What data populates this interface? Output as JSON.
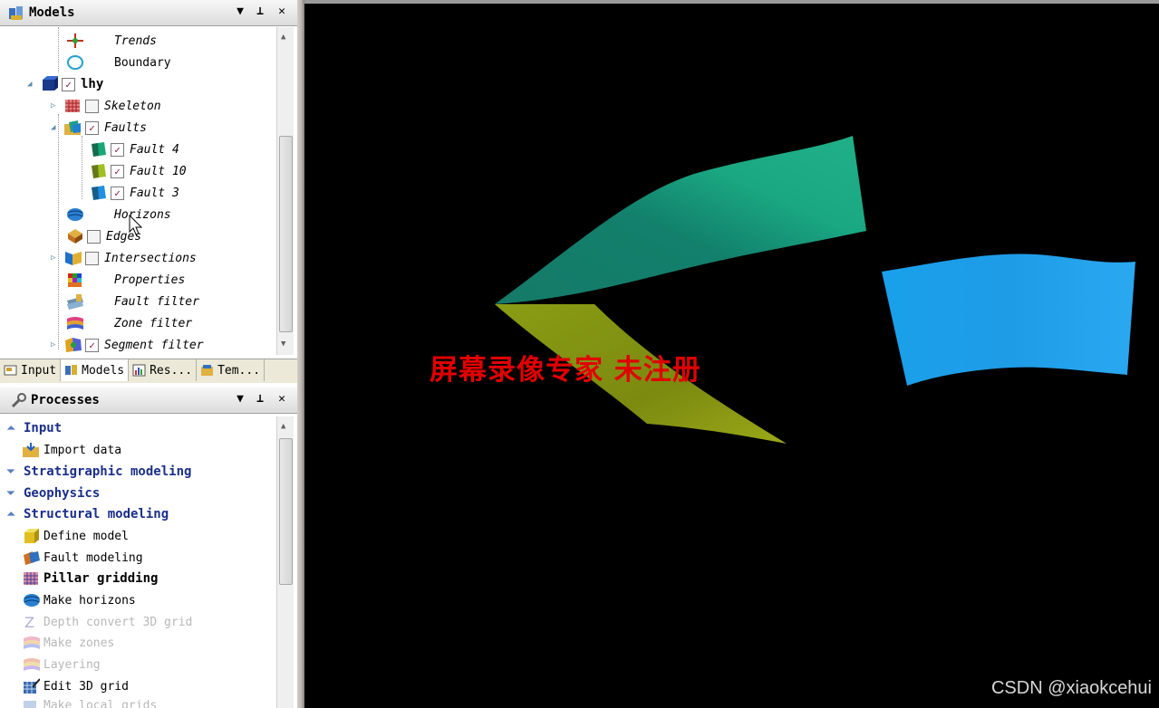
{
  "models_panel": {
    "title": "Models",
    "tree": [
      {
        "label": "Trends",
        "italic": true,
        "checkbox": "none"
      },
      {
        "label": "Boundary",
        "italic": false,
        "checkbox": "none"
      },
      {
        "label": "lhy",
        "bold": true,
        "checkbox": "checked"
      },
      {
        "label": "Skeleton",
        "italic": true,
        "checkbox": "empty"
      },
      {
        "label": "Faults",
        "italic": true,
        "checkbox": "checked"
      },
      {
        "label": "Fault 4",
        "italic": true,
        "checkbox": "checked"
      },
      {
        "label": "Fault 10",
        "italic": true,
        "checkbox": "checked"
      },
      {
        "label": "Fault 3",
        "italic": true,
        "checkbox": "checked"
      },
      {
        "label": "Horizons",
        "italic": true,
        "checkbox": "none"
      },
      {
        "label": "Edges",
        "italic": true,
        "checkbox": "empty"
      },
      {
        "label": "Intersections",
        "italic": true,
        "checkbox": "empty"
      },
      {
        "label": "Properties",
        "italic": true,
        "checkbox": "none"
      },
      {
        "label": "Fault filter",
        "italic": true,
        "checkbox": "none"
      },
      {
        "label": "Zone filter",
        "italic": true,
        "checkbox": "none"
      },
      {
        "label": "Segment filter",
        "italic": true,
        "checkbox": "checked"
      }
    ]
  },
  "tabs": [
    "Input",
    "Models",
    "Res...",
    "Tem..."
  ],
  "processes_panel": {
    "title": "Processes",
    "items": [
      {
        "label": "Input",
        "type": "head",
        "state": "expanded"
      },
      {
        "label": "Import data",
        "type": "item"
      },
      {
        "label": "Stratigraphic modeling",
        "type": "head",
        "state": "collapsed"
      },
      {
        "label": "Geophysics",
        "type": "head",
        "state": "collapsed"
      },
      {
        "label": "Structural modeling",
        "type": "head",
        "state": "expanded"
      },
      {
        "label": "Define model",
        "type": "item"
      },
      {
        "label": "Fault modeling",
        "type": "item"
      },
      {
        "label": "Pillar gridding",
        "type": "item",
        "bold": true
      },
      {
        "label": "Make horizons",
        "type": "item"
      },
      {
        "label": "Depth convert 3D grid",
        "type": "item",
        "disabled": true
      },
      {
        "label": "Make zones",
        "type": "item",
        "disabled": true
      },
      {
        "label": "Layering",
        "type": "item",
        "disabled": true
      },
      {
        "label": "Edit 3D grid",
        "type": "item"
      },
      {
        "label": "Make local grids",
        "type": "item",
        "disabled": true
      }
    ]
  },
  "header_controls": {
    "dropdown": "▼",
    "pin": "⊥",
    "close": "✕"
  },
  "viewport": {
    "watermark": "屏幕录像专家  未注册",
    "credit": "CSDN @xiaokcehui",
    "colors": {
      "fault_green": "#1aa882",
      "fault_yellow": "#8d9a12",
      "fault_blue": "#1a9ee8",
      "watermark": "#e00000"
    }
  }
}
